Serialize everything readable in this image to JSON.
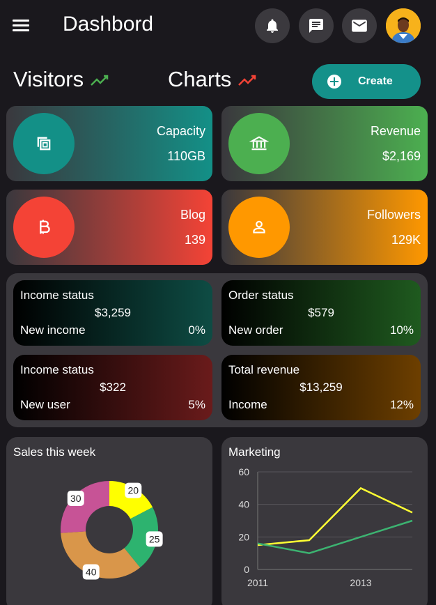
{
  "header": {
    "title": "Dashbord",
    "icons": [
      "menu-icon",
      "bell-icon",
      "chat-icon",
      "mail-icon",
      "user-avatar"
    ]
  },
  "sections": {
    "visitors": "Visitors",
    "charts": "Charts",
    "create_label": "Create"
  },
  "stats": [
    {
      "label": "Capacity",
      "value": "110GB",
      "icon": "copy-icon",
      "color": "#139087"
    },
    {
      "label": "Revenue",
      "value": "$2,169",
      "icon": "bank-icon",
      "color": "#4caf50"
    },
    {
      "label": "Blog",
      "value": "139",
      "icon": "bitcoin-icon",
      "color": "#f44336"
    },
    {
      "label": "Followers",
      "value": "129K",
      "icon": "user-icon",
      "color": "#ff9800"
    }
  ],
  "status": [
    {
      "title": "Income status",
      "value": "$3,259",
      "sub": "New income",
      "pct": "0%"
    },
    {
      "title": "Order status",
      "value": "$579",
      "sub": "New order",
      "pct": "10%"
    },
    {
      "title": "Income status",
      "value": "$322",
      "sub": "New user",
      "pct": "5%"
    },
    {
      "title": "Total revenue",
      "value": "$13,259",
      "sub": "Income",
      "pct": "12%"
    }
  ],
  "charts": {
    "sales_title": "Sales this week",
    "marketing_title": "Marketing"
  },
  "chart_data": [
    {
      "type": "pie",
      "title": "Sales this week",
      "categories": [
        "20",
        "25",
        "40",
        "30"
      ],
      "values": [
        20,
        25,
        40,
        30
      ],
      "colors": [
        "#ffff00",
        "#2db36f",
        "#d9964a",
        "#c75396"
      ]
    },
    {
      "type": "line",
      "title": "Marketing",
      "x": [
        2011,
        2012,
        2013,
        2014
      ],
      "xticks": [
        "2011",
        "2013"
      ],
      "yticks": [
        "0",
        "20",
        "40",
        "60"
      ],
      "ylim": [
        0,
        60
      ],
      "series": [
        {
          "color": "#ffff33",
          "values": [
            15,
            18,
            50,
            35
          ]
        },
        {
          "color": "#3cb371",
          "values": [
            16,
            10,
            20,
            30
          ]
        }
      ]
    }
  ]
}
